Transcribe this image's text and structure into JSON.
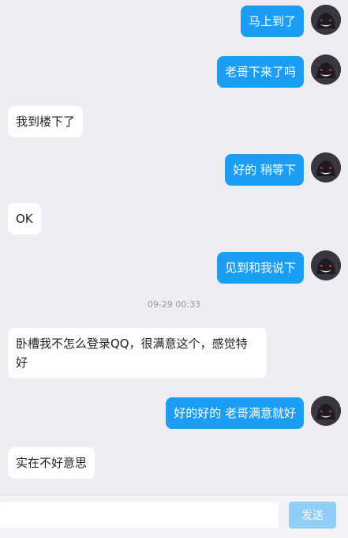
{
  "messages": [
    {
      "side": "me",
      "text": "马上到了"
    },
    {
      "side": "me",
      "text": "老哥下来了吗"
    },
    {
      "side": "them",
      "text": "我到楼下了"
    },
    {
      "side": "me",
      "text": "好的 稍等下"
    },
    {
      "side": "them",
      "text": "OK"
    },
    {
      "side": "me",
      "text": "见到和我说下"
    },
    {
      "side": "them",
      "text": "卧槽我不怎么登录QQ，很满意这个，感觉特好"
    },
    {
      "side": "me",
      "text": "好的好的 老哥满意就好"
    },
    {
      "side": "them",
      "text": "实在不好意思"
    }
  ],
  "timestamp": "09-29 00:33",
  "composer": {
    "placeholder": "",
    "send_label": "发送"
  },
  "colors": {
    "my_bubble": "#1c9df4",
    "their_bubble": "#ffffff",
    "background": "#eeedf3",
    "send_disabled": "#90cdf7"
  },
  "avatar_icon": "ghost-avatar-icon"
}
